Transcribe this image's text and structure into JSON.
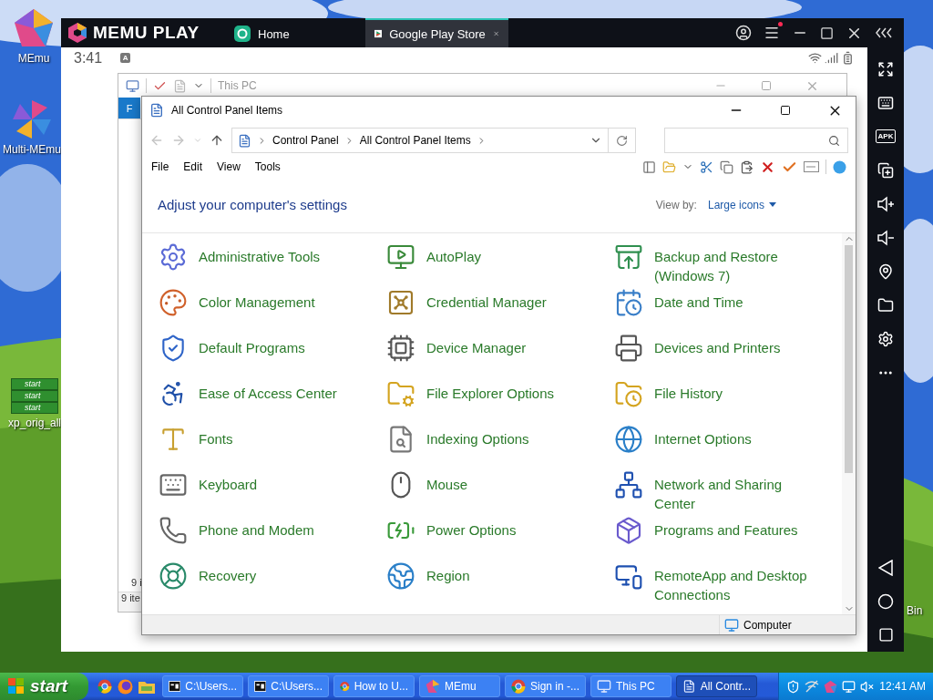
{
  "desktop": {
    "icons": [
      {
        "kind": "pentagon",
        "label": "MEmu"
      },
      {
        "kind": "pinwheel",
        "label": "Multi-MEmu"
      },
      {
        "kind": "thumbnail",
        "label": "xp_orig_all",
        "thumbnail_labels": [
          "start",
          "start",
          "start"
        ]
      },
      {
        "kind": "label_only",
        "label": "Bin"
      }
    ]
  },
  "emulator": {
    "logo": "MEMU PLAY",
    "tabs": [
      {
        "label": "Home",
        "selected": false
      },
      {
        "label": "Google Play Store",
        "selected": true
      }
    ],
    "status_bar": {
      "time": "3:41",
      "notification": "A"
    },
    "sidebar": {
      "apk_label": "APK"
    }
  },
  "back_window": {
    "title": "This PC",
    "ribbon_tab": "F",
    "item_count": "9 i",
    "status": "9 ite"
  },
  "control_panel": {
    "title": "All Control Panel Items",
    "breadcrumb": [
      "Control Panel",
      "All Control Panel Items"
    ],
    "menu": [
      "File",
      "Edit",
      "View",
      "Tools"
    ],
    "heading": "Adjust your computer's settings",
    "view_by_label": "View by:",
    "view_by_value": "Large icons",
    "items": [
      {
        "label": "Administrative Tools"
      },
      {
        "label": "AutoPlay"
      },
      {
        "label": "Backup and Restore (Windows 7)"
      },
      {
        "label": "Color Management"
      },
      {
        "label": "Credential Manager"
      },
      {
        "label": "Date and Time"
      },
      {
        "label": "Default Programs"
      },
      {
        "label": "Device Manager"
      },
      {
        "label": "Devices and Printers"
      },
      {
        "label": "Ease of Access Center"
      },
      {
        "label": "File Explorer Options"
      },
      {
        "label": "File History"
      },
      {
        "label": "Fonts"
      },
      {
        "label": "Indexing Options"
      },
      {
        "label": "Internet Options"
      },
      {
        "label": "Keyboard"
      },
      {
        "label": "Mouse"
      },
      {
        "label": "Network and Sharing Center"
      },
      {
        "label": "Phone and Modem"
      },
      {
        "label": "Power Options"
      },
      {
        "label": "Programs and Features"
      },
      {
        "label": "Recovery"
      },
      {
        "label": "Region"
      },
      {
        "label": "RemoteApp and Desktop Connections"
      }
    ],
    "status": "Computer"
  },
  "taskbar": {
    "start": "start",
    "tasks": [
      {
        "kind": "archive",
        "label": "C:\\Users...",
        "selected": false
      },
      {
        "kind": "archive",
        "label": "C:\\Users...",
        "selected": false
      },
      {
        "kind": "browser",
        "label": "How to U...",
        "selected": false
      },
      {
        "kind": "emulator",
        "label": "MEmu",
        "selected": false
      },
      {
        "kind": "browser",
        "label": "Sign in -...",
        "selected": false
      },
      {
        "kind": "explorer",
        "label": "This PC",
        "selected": false
      },
      {
        "kind": "control",
        "label": "All Contr...",
        "selected": true
      }
    ],
    "clock": "12:41 AM"
  }
}
